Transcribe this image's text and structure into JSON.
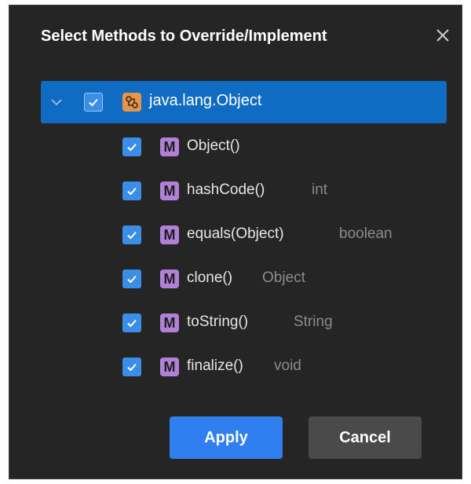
{
  "dialog": {
    "title": "Select Methods to Override/Implement",
    "close_icon": "close-icon"
  },
  "tree": {
    "root": {
      "label": "java.lang.Object",
      "checked": true,
      "expanded": true,
      "icon": "class-icon"
    },
    "methods": [
      {
        "name": "Object()",
        "return_type": "",
        "checked": true,
        "icon": "M"
      },
      {
        "name": "hashCode()",
        "return_type": "int",
        "checked": true,
        "icon": "M"
      },
      {
        "name": "equals(Object)",
        "return_type": "boolean",
        "checked": true,
        "icon": "M"
      },
      {
        "name": "clone()",
        "return_type": "Object",
        "checked": true,
        "icon": "M"
      },
      {
        "name": "toString()",
        "return_type": "String",
        "checked": true,
        "icon": "M"
      },
      {
        "name": "finalize()",
        "return_type": "void",
        "checked": true,
        "icon": "M"
      }
    ]
  },
  "buttons": {
    "apply_label": "Apply",
    "cancel_label": "Cancel"
  },
  "colors": {
    "dialog_bg": "#252526",
    "selection": "#0f6cc2",
    "checkbox": "#3a8ee6",
    "method_icon": "#b180d7",
    "class_icon": "#e8934a",
    "apply_bg": "#2f7ff0",
    "cancel_bg": "#4a4a4a",
    "return_type_text": "#8b8b8b"
  }
}
